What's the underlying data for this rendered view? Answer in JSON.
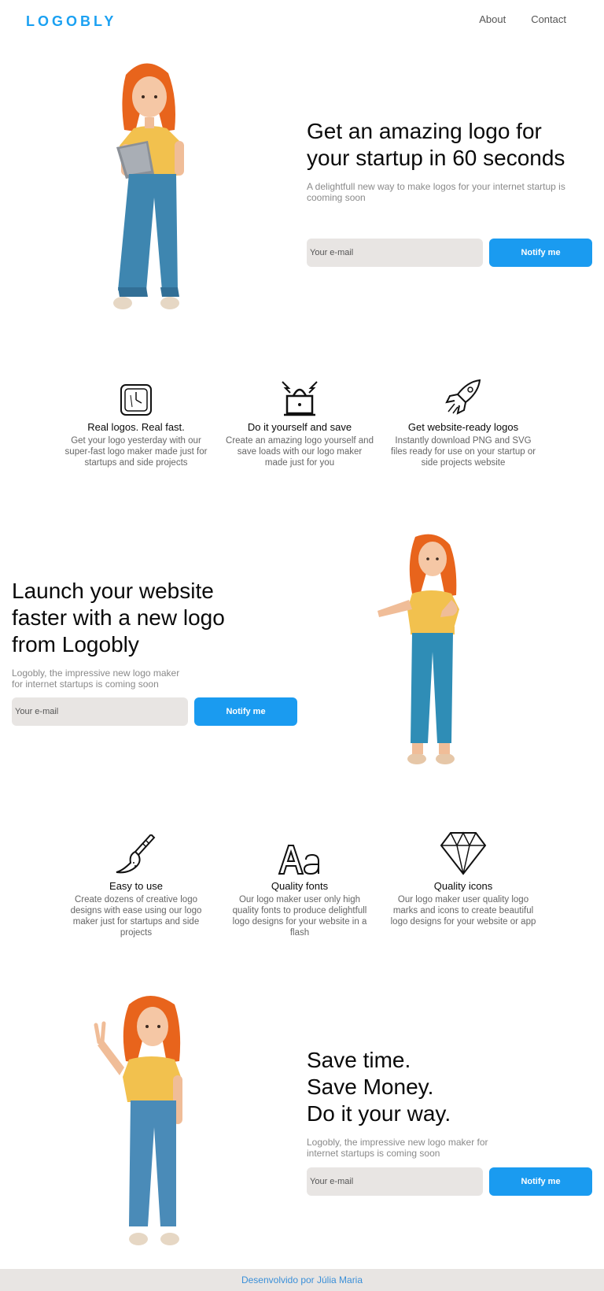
{
  "header": {
    "logo": "LOGOBLY",
    "nav": [
      {
        "label": "About"
      },
      {
        "label": "Contact"
      }
    ]
  },
  "hero1": {
    "title": "Get an amazing logo for your startup in 60 seconds",
    "subtitle": "A delightfull new way to make logos for your internet startup is cooming soon",
    "email_placeholder": "Your e-mail",
    "button": "Notify me"
  },
  "features1": [
    {
      "icon": "clock-icon",
      "title": "Real logos. Real fast.",
      "text": "Get your logo yesterday with our super-fast logo maker made just for startups and side projects"
    },
    {
      "icon": "box-icon",
      "title": "Do it yourself and save",
      "text": "Create an amazing logo yourself and save loads with our logo maker made just for you"
    },
    {
      "icon": "rocket-icon",
      "title": "Get website-ready logos",
      "text": "Instantly download PNG and SVG files ready for use on your startup or side projects website"
    }
  ],
  "hero2": {
    "title": "Launch your website faster with a new logo from Logobly",
    "subtitle": "Logobly, the impressive new logo maker for internet startups is coming soon",
    "email_placeholder": "Your e-mail",
    "button": "Notify me"
  },
  "features2": [
    {
      "icon": "brush-icon",
      "title": "Easy to use",
      "text": "Create dozens of creative logo designs with ease using our logo maker just for startups and side projects"
    },
    {
      "icon": "font-icon",
      "title": "Quality fonts",
      "text": "Our logo maker user only high quality fonts to produce delightfull logo designs for your website in a flash"
    },
    {
      "icon": "diamond-icon",
      "title": "Quality icons",
      "text": "Our logo maker user quality logo marks and icons to create beautiful logo designs for your website or app"
    }
  ],
  "hero3": {
    "title_lines": [
      "Save time.",
      "Save Money.",
      "Do it your way."
    ],
    "subtitle": "Logobly, the impressive new logo maker for internet startups is coming soon",
    "email_placeholder": "Your e-mail",
    "button": "Notify me"
  },
  "footer": {
    "text": "Desenvolvido por Júlia Maria"
  },
  "colors": {
    "brand": "#1ba1f2",
    "button": "#1a9bf0",
    "input_bg": "#e8e5e3",
    "hair": "#e8641c",
    "shirt": "#f2c14e",
    "jeans": "#3e86b0"
  }
}
